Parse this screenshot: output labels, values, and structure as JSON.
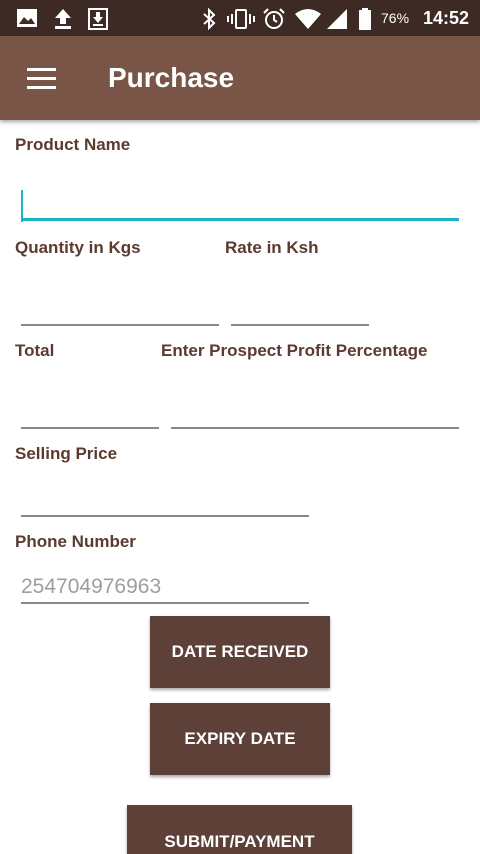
{
  "status_bar": {
    "icons": [
      "image-icon",
      "upload-icon",
      "download-icon",
      "bluetooth-icon",
      "vibrate-icon",
      "alarm-icon",
      "wifi-icon",
      "signal-icon",
      "battery-icon"
    ],
    "battery": "76%",
    "time": "14:52"
  },
  "app_bar": {
    "title": "Purchase",
    "menu_icon": "menu-icon"
  },
  "form": {
    "product_name_label": "Product Name",
    "product_name_value": "",
    "quantity_label": "Quantity in Kgs",
    "quantity_value": "",
    "rate_label": "Rate in Ksh",
    "rate_value": "",
    "total_label": "Total",
    "total_value": "",
    "profit_label": "Enter Prospect Profit Percentage",
    "profit_value": "",
    "selling_price_label": "Selling Price",
    "selling_price_value": "",
    "phone_label": "Phone Number",
    "phone_placeholder": "254704976963"
  },
  "buttons": {
    "date_received": "DATE RECEIVED",
    "expiry_date": "EXPIRY DATE",
    "submit": "SUBMIT/PAYMENT"
  },
  "colors": {
    "status_bar": "#3e2a24",
    "app_bar": "#795548",
    "button": "#5d4037",
    "label": "#5b3a30",
    "focus_accent": "#1fb3c2"
  }
}
